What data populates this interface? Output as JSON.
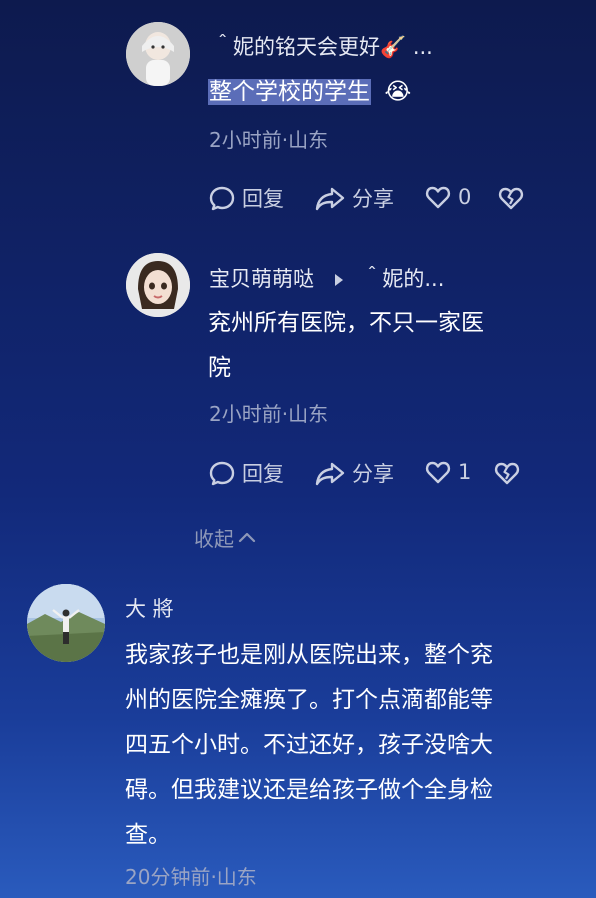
{
  "comments": [
    {
      "user": "＾妮的铭天会更好🎸 ...",
      "text_selected": "整个学校的学生",
      "emoji": "😭",
      "meta": "2小时前·山东",
      "actions": {
        "reply": "回复",
        "share": "分享",
        "likes": "0"
      }
    },
    {
      "user": "宝贝萌萌哒",
      "reply_to": "＾妮的...",
      "text_line1": "兖州所有医院，不只一家医",
      "text_line2": "院",
      "meta": "2小时前·山东",
      "actions": {
        "reply": "回复",
        "share": "分享",
        "likes": "1"
      }
    }
  ],
  "collapse_label": "收起",
  "main_comment": {
    "user": "大 將",
    "lines": [
      "我家孩子也是刚从医院出来，整个兖",
      "州的医院全瘫痪了。打个点滴都能等",
      "四五个小时。不过还好，孩子没啥大",
      "碍。但我建议还是给孩子做个全身检",
      "查。"
    ],
    "meta": "20分钟前·山东"
  },
  "icons": [
    "reply-icon",
    "share-icon",
    "heart-icon",
    "broken-heart-icon",
    "chevron-up-icon",
    "play-triangle-icon"
  ]
}
